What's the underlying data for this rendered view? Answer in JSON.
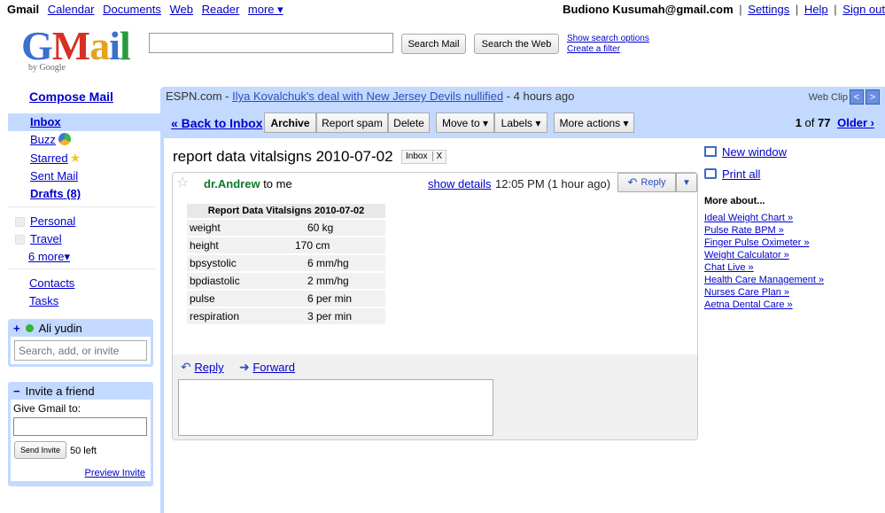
{
  "topbar": {
    "brand": "Gmail",
    "links": [
      "Calendar",
      "Documents",
      "Web",
      "Reader",
      "more ▾"
    ],
    "user": "Budiono Kusumah@gmail.com",
    "settings": "Settings",
    "help": "Help",
    "signout": "Sign out",
    "sep": "|"
  },
  "logo": {
    "g": "G",
    "m": "M",
    "a": "a",
    "i": "i",
    "l": "l",
    "by": "by Google"
  },
  "search": {
    "value": "",
    "search_mail": "Search Mail",
    "search_web": "Search the Web",
    "show_options": "Show search options",
    "create_filter": "Create a filter"
  },
  "nav": {
    "compose": "Compose Mail",
    "inbox": "Inbox",
    "buzz": "Buzz",
    "starred": "Starred",
    "sent": "Sent Mail",
    "drafts": "Drafts (8)",
    "personal": "Personal",
    "travel": "Travel",
    "more": "6 more▾",
    "contacts": "Contacts",
    "tasks": "Tasks"
  },
  "chat": {
    "plus": "+",
    "user": "Ali yudin",
    "placeholder": "Search, add, or invite"
  },
  "invite": {
    "minus": "−",
    "title": "Invite a friend",
    "label": "Give Gmail to:",
    "send": "Send Invite",
    "left": "50 left",
    "preview": "Preview Invite"
  },
  "webclip": {
    "source": "ESPN.com - ",
    "headline": "Ilya Kovalchuk's deal with New Jersey Devils nullified",
    "age": " - 4 hours ago",
    "label": "Web Clip",
    "prev": "<",
    "next": ">"
  },
  "toolbar": {
    "back": "« Back to Inbox",
    "archive": "Archive",
    "spam": "Report spam",
    "delete": "Delete",
    "move": "Move to ▾",
    "labels": "Labels ▾",
    "more_actions": "More actions ▾",
    "page_current": "1",
    "page_of": " of ",
    "page_total": "77",
    "older": "Older ›"
  },
  "message": {
    "subject": "report data vitalsigns 2010-07-02",
    "tag": "Inbox",
    "tag_close": "X",
    "star": "☆",
    "sender": "dr.Andrew",
    "to": " to me",
    "show_details": "show details",
    "time": "12:05 PM (1 hour ago)",
    "reply_btn": "Reply",
    "reply_more": "▼",
    "reply_link": "Reply",
    "forward_link": "Forward"
  },
  "vitals": {
    "header": "Report Data Vitalsigns 2010-07-02",
    "rows": [
      {
        "k": "weight",
        "v": "60 kg"
      },
      {
        "k": "height",
        "v": "170 cm"
      },
      {
        "k": "bpsystolic",
        "v": "6 mm/hg"
      },
      {
        "k": "bpdiastolic",
        "v": "2 mm/hg"
      },
      {
        "k": "pulse",
        "v": "6 per min"
      },
      {
        "k": "respiration",
        "v": "3 per min"
      }
    ]
  },
  "side": {
    "new_window": "New window",
    "print_all": "Print all",
    "more_about": "More about...",
    "links": [
      "Ideal Weight Chart »",
      "Pulse Rate BPM »",
      "Finger Pulse Oximeter »",
      "Weight Calculator »",
      "Chat Live »",
      "Health Care Management »",
      "Nurses Care Plan »",
      "Aetna Dental Care »"
    ]
  },
  "colors": {
    "accent": "#c3d9ff",
    "link": "#0000cc",
    "sender": "#0a7a2a"
  }
}
